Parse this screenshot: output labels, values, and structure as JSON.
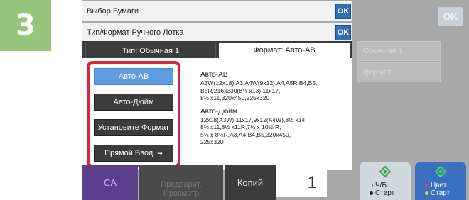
{
  "step": {
    "number": "3"
  },
  "dialog": {
    "rows": [
      {
        "label": "Выбор Бумаги",
        "ok": "OK"
      },
      {
        "label": "Тип/Формат Ручного Лотка",
        "ok": "OK"
      }
    ],
    "tabs": {
      "type": "Тип:   Обычная 1",
      "format": "Формат:   Авто-AB"
    },
    "format_buttons": [
      {
        "label": "Авто-AB",
        "selected": true
      },
      {
        "label": "Авто-Дюйм",
        "selected": false
      },
      {
        "label": "Установите Формат",
        "selected": false
      },
      {
        "label": "Прямой Ввод",
        "selected": false,
        "icon": "arrow-right-icon"
      }
    ],
    "info": {
      "auto_ab_title": "Авто-AB",
      "auto_ab_sizes": "A3W(12x18),A3,A4W(9x12),A4,A5R,B4,B5,\nB5R,216x330(8½ x13),11x17,\n8½ x11,320x450,225x320",
      "auto_inch_title": "Авто-Дюйм",
      "auto_inch_sizes": "12x18(A3W),11x17,9x12(A4W),8½ x14,\n8½ x11,8½ x11R,7¼ x 10½ R,\n5½ x 8½R,A3,A4,B4,B5,320x450,\n225x320"
    }
  },
  "background": {
    "ok": "OK",
    "field1": "Обычная 1",
    "field2": "формат"
  },
  "bottom": {
    "ca": "CA",
    "preview_line1": "Предварит.",
    "preview_line2": "Просмотр",
    "copies_label": "Копий",
    "copies_value": "1",
    "start_bw_line1": "Ч/Б",
    "start_bw_line2": "Старт",
    "start_color_line1": "Цвет",
    "start_color_line2": "Старт"
  },
  "colors": {
    "highlight": "#d9263c",
    "ok_blue": "#2f6fb8",
    "selected_button": "#5f9de0",
    "step_badge": "#96c47a",
    "start_color": "#3b6fbf"
  }
}
